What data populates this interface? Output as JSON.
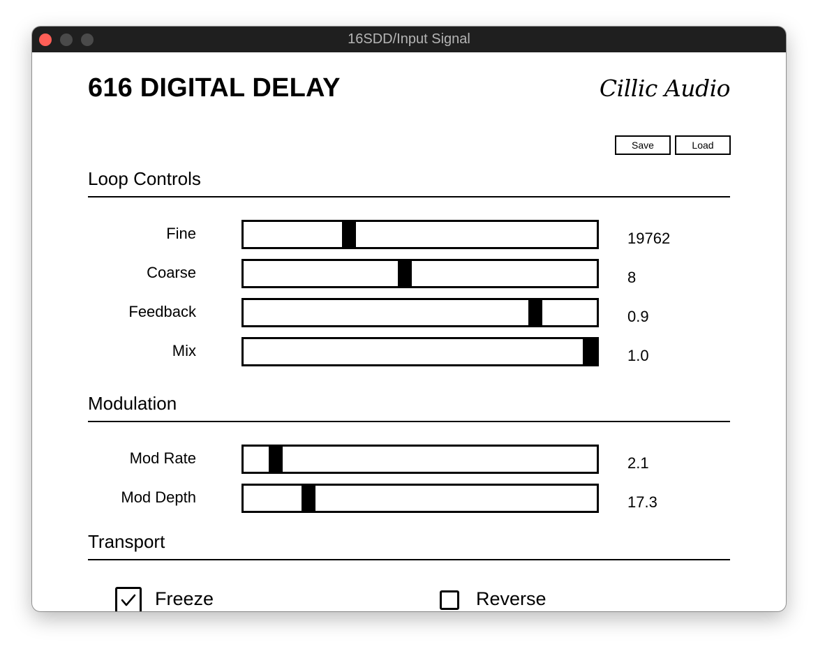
{
  "window": {
    "title": "16SDD/Input Signal"
  },
  "header": {
    "title": "616 DIGITAL DELAY",
    "brand": "Cillic Audio",
    "save_label": "Save",
    "load_label": "Load"
  },
  "sections": {
    "loop": {
      "title": "Loop Controls",
      "sliders": [
        {
          "label": "Fine",
          "value": "19762",
          "position": 0.29
        },
        {
          "label": "Coarse",
          "value": "8",
          "position": 0.455
        },
        {
          "label": "Feedback",
          "value": "0.9",
          "position": 0.84
        },
        {
          "label": "Mix",
          "value": "1.0",
          "position": 1.0
        }
      ]
    },
    "modulation": {
      "title": "Modulation",
      "sliders": [
        {
          "label": "Mod Rate",
          "value": "2.1",
          "position": 0.075
        },
        {
          "label": "Mod Depth",
          "value": "17.3",
          "position": 0.17
        }
      ]
    },
    "transport": {
      "title": "Transport",
      "freeze": {
        "label": "Freeze",
        "checked": true
      },
      "reverse": {
        "label": "Reverse",
        "checked": false
      }
    }
  },
  "colors": {
    "titlebar": "#1f1f1f",
    "close_button": "#ff5f57",
    "inactive_button": "#4a4a4a",
    "accent": "#000000"
  }
}
